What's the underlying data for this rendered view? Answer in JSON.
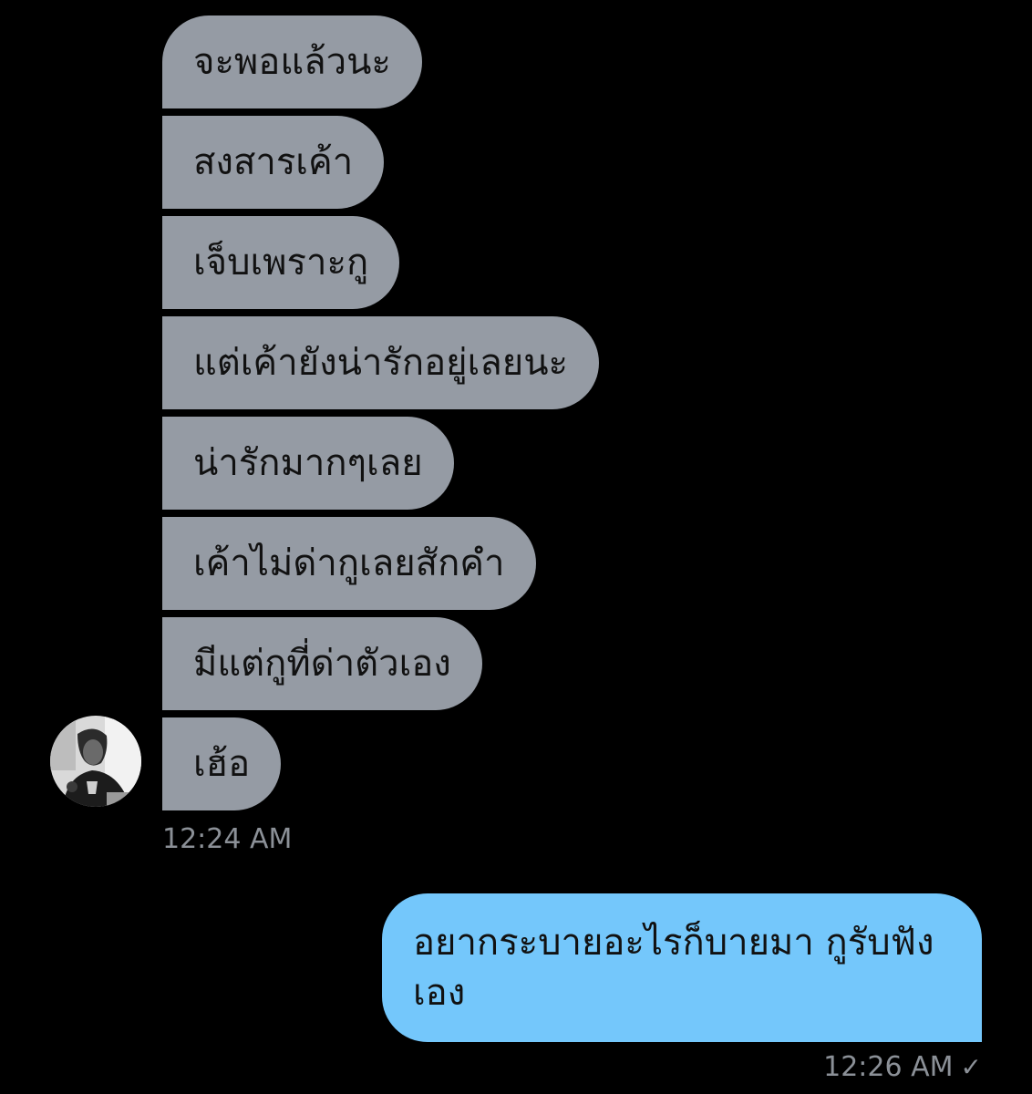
{
  "received_messages": [
    "จะพอแล้วนะ",
    "สงสารเค้า",
    "เจ็บเพราะกู",
    "แต่เค้ายังน่ารักอยู่เลยนะ",
    "น่ารักมากๆเลย",
    "เค้าไม่ด่ากูเลยสักคำ",
    "มีแต่กูที่ด่าตัวเอง",
    "เฮ้อ"
  ],
  "received_time": "12:24 AM",
  "sent_message": "อยากระบายอะไรก็บายมา กูรับฟังเอง",
  "sent_time": "12:26 AM",
  "sent_status_icon": "✓",
  "colors": {
    "background": "#000000",
    "received_bubble": "#959ba4",
    "sent_bubble": "#74c7fb",
    "timestamp": "#8b9097"
  },
  "icons": {
    "avatar": "contact-avatar",
    "read_status": "check-icon"
  }
}
